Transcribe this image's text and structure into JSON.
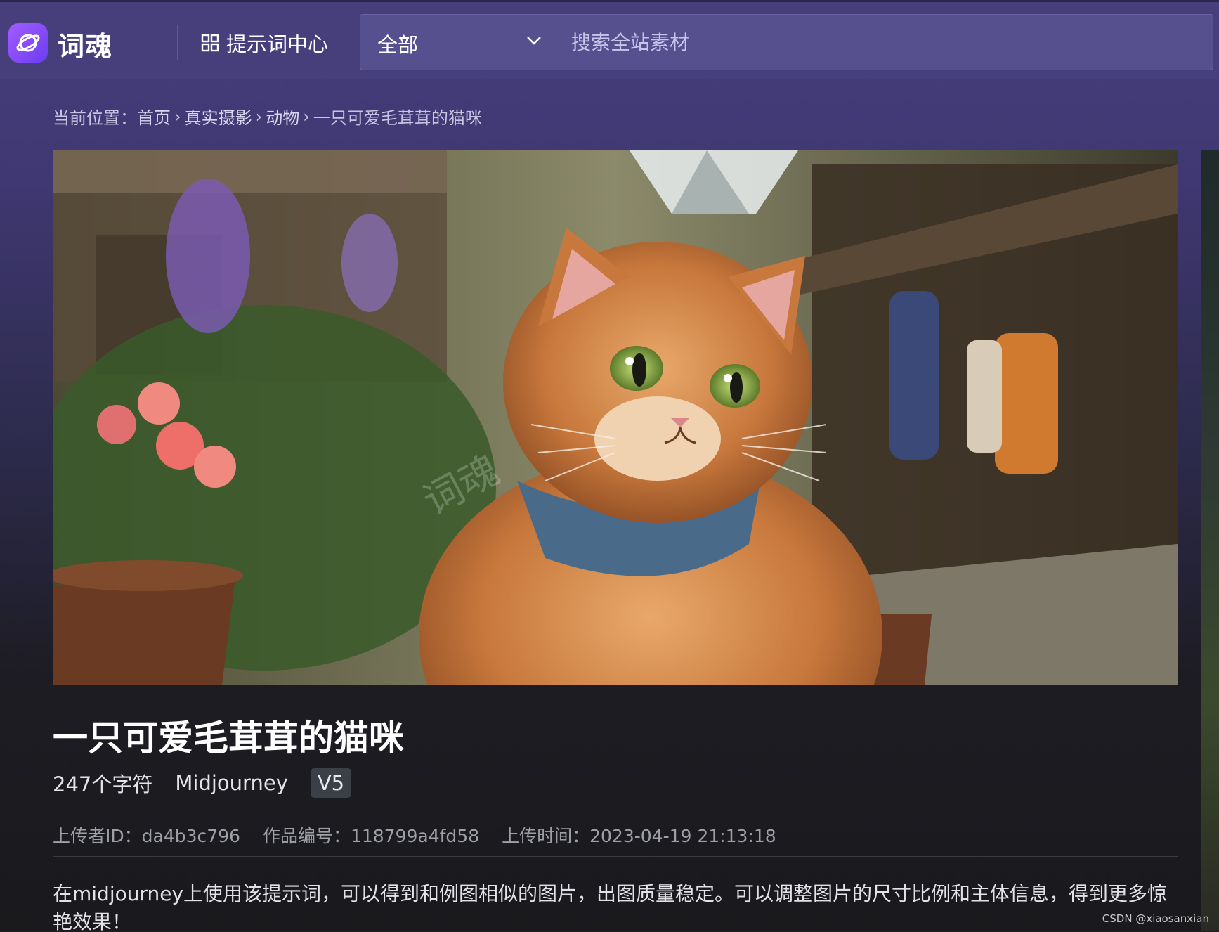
{
  "header": {
    "brand": "词魂",
    "nav_prompt_label": "提示词中心",
    "search": {
      "category_selected": "全部",
      "placeholder": "搜索全站素材",
      "value": ""
    }
  },
  "breadcrumb": {
    "prefix": "当前位置：",
    "items": [
      "首页",
      "真实摄影",
      "动物",
      "一只可爱毛茸茸的猫咪"
    ]
  },
  "artwork": {
    "title": "一只可爱毛茸茸的猫咪",
    "char_count": "247个字符",
    "model": "Midjourney",
    "version": "V5",
    "uploader": "上传者ID：da4b3c796",
    "work_id": "作品编号：118799a4fd58",
    "upload_time": "上传时间：2023-04-19 21:13:18",
    "description": "在midjourney上使用该提示词，可以得到和例图相似的图片，出图质量稳定。可以调整图片的尺寸比例和主体信息，得到更多惊艳效果！",
    "image_watermark": "词魂"
  },
  "footer_watermark": "CSDN @xiaosanxian",
  "colors": {
    "header_bg": "#463f7c",
    "search_bg": "#57508f",
    "logo_gradient": [
      "#a45cff",
      "#6b3df0"
    ],
    "page_bottom": "#1a1a1d"
  }
}
